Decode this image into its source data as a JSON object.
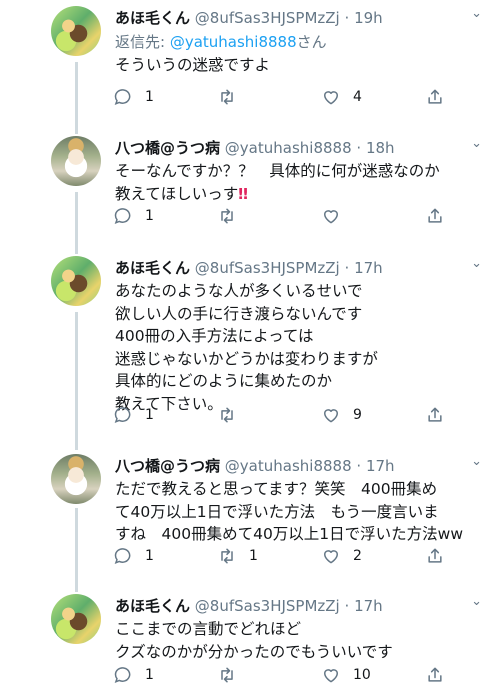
{
  "tweets": [
    {
      "name": "あほ毛くん",
      "handle": "@8ufSas3HJSPMzZj",
      "dot": "·",
      "time": "19h",
      "reply_prefix": "返信先: ",
      "reply_mention": "@yatuhashi8888",
      "reply_suffix": "さん",
      "text": "そういうの迷惑ですよ",
      "reply_count": "1",
      "retweet_count": "",
      "like_count": "4"
    },
    {
      "name": "八つ橋@うつ病",
      "handle": "@yatuhashi8888",
      "dot": "·",
      "time": "18h",
      "text": "そーなんですか？？　具体的に何が迷惑なのか\n教えてほしいっす",
      "emoji": "‼",
      "reply_count": "1",
      "retweet_count": "",
      "like_count": ""
    },
    {
      "name": "あほ毛くん",
      "handle": "@8ufSas3HJSPMzZj",
      "dot": "·",
      "time": "17h",
      "text": "あなたのような人が多くいるせいで\n欲しい人の手に行き渡らないんです\n400冊の入手方法によっては\n迷惑じゃないかどうかは変わりますが\n具体的にどのように集めたのか\n教えて下さい。",
      "reply_count": "1",
      "retweet_count": "",
      "like_count": "9"
    },
    {
      "name": "八つ橋@うつ病",
      "handle": "@yatuhashi8888",
      "dot": "·",
      "time": "17h",
      "text": "ただで教えると思ってます？笑笑　400冊集め\nて40万以上1日で浮いた方法　もう一度言いま\nすね　400冊集めて40万以上1日で浮いた方法ww",
      "reply_count": "1",
      "retweet_count": "1",
      "like_count": "2"
    },
    {
      "name": "あほ毛くん",
      "handle": "@8ufSas3HJSPMzZj",
      "dot": "·",
      "time": "17h",
      "text": "ここまでの言動でどれほど\nクズなのかが分かったのでもういいです",
      "reply_count": "1",
      "retweet_count": "",
      "like_count": "10"
    }
  ],
  "icons": {
    "reply": "reply-icon",
    "retweet": "retweet-icon",
    "like": "heart-icon",
    "share": "share-icon",
    "more": "chevron-down-icon"
  },
  "colors": {
    "mention": "#1da1f2",
    "secondary_text": "#657786",
    "thread_line": "#cfd9de",
    "emoji_red": "#e0245e"
  }
}
